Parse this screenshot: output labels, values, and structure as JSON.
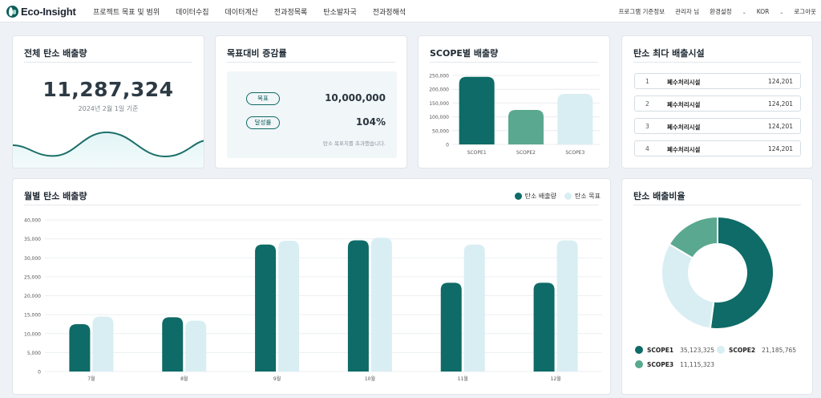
{
  "brand": {
    "name": "Eco-Insight"
  },
  "nav": [
    "프로젝트 목표 및 범위",
    "데이터수집",
    "데이터계산",
    "전과정목록",
    "탄소발자국",
    "전과정해석"
  ],
  "util": {
    "basis": "프로그램 기준정보",
    "user": "관리자 님",
    "settings": "환경설정",
    "lang": "KOR",
    "logout": "로그아웃"
  },
  "total": {
    "title": "전체 탄소 배출량",
    "value": "11,287,324",
    "date": "2024년 2월 1일 기준"
  },
  "target": {
    "title": "목표대비 증감률",
    "goal_label": "목표",
    "goal_value": "10,000,000",
    "rate_label": "달성률",
    "rate_value": "104%",
    "note": "탄소 목표치를 초과했습니다."
  },
  "scope": {
    "title": "SCOPE별 배출량"
  },
  "facilities": {
    "title": "탄소 최다 배출시설",
    "items": [
      {
        "rank": "1",
        "name": "폐수처리시설",
        "value": "124,201"
      },
      {
        "rank": "2",
        "name": "폐수처리시설",
        "value": "124,201"
      },
      {
        "rank": "3",
        "name": "폐수처리시설",
        "value": "124,201"
      },
      {
        "rank": "4",
        "name": "폐수처리시설",
        "value": "124,201"
      }
    ]
  },
  "monthly": {
    "title": "월별 탄소 배출량",
    "legend": [
      "탄소 배출량",
      "탄소 목표"
    ]
  },
  "ratio": {
    "title": "탄소 배출비율",
    "items": [
      {
        "name": "SCOPE1",
        "value": "35,123,325"
      },
      {
        "name": "SCOPE2",
        "value": "21,185,765"
      },
      {
        "name": "SCOPE3",
        "value": "11,115,323"
      }
    ]
  },
  "colors": {
    "dark": "#0e6b67",
    "light": "#d9eef3",
    "mid": "#5aa890"
  },
  "chart_data": [
    {
      "type": "bar",
      "title": "SCOPE별 배출량",
      "categories": [
        "SCOPE1",
        "SCOPE2",
        "SCOPE3"
      ],
      "values": [
        245000,
        125000,
        183000
      ],
      "bar_colors": [
        "#0e6b67",
        "#5aa890",
        "#d9eef3"
      ],
      "ylim": [
        0,
        250000
      ],
      "yticks": [
        "0",
        "50,000",
        "100,000",
        "150,000",
        "200,000",
        "250,000"
      ],
      "grid": true
    },
    {
      "type": "bar",
      "title": "월별 탄소 배출량",
      "categories": [
        "7월",
        "8월",
        "9월",
        "10월",
        "11월",
        "12월"
      ],
      "series": [
        {
          "name": "탄소 배출량",
          "values": [
            12500,
            14300,
            33500,
            34600,
            23400,
            23400
          ],
          "color": "#0e6b67"
        },
        {
          "name": "탄소 목표",
          "values": [
            14500,
            13400,
            34500,
            35300,
            33500,
            34600
          ],
          "color": "#d9eef3"
        }
      ],
      "ylim": [
        0,
        40000
      ],
      "yticks": [
        "0",
        "5,000",
        "10,000",
        "15,000",
        "20,000",
        "25,000",
        "30,000",
        "35,000",
        "40,000"
      ],
      "legend": "top-right",
      "grid": true
    },
    {
      "type": "pie",
      "title": "탄소 배출비율",
      "categories": [
        "SCOPE1",
        "SCOPE2",
        "SCOPE3"
      ],
      "values": [
        35123325,
        21185765,
        11115323
      ],
      "colors": [
        "#0e6b67",
        "#d9eef3",
        "#5aa890"
      ],
      "donut": true
    }
  ]
}
